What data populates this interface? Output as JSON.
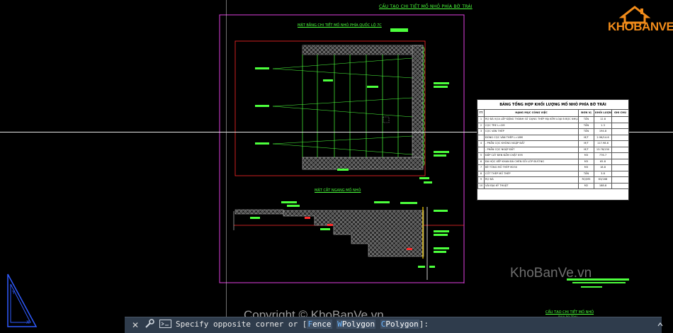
{
  "sheet_title": "CẤU TẠO CHI TIẾT MỐ NHỎ PHÍA BỜ TRÁI",
  "plan_view_label": "MẶT BẰNG CHI TIẾT MỐ NHỎ PHÍA QUỐC LỘ 7C",
  "section_view_label": "MẶT CẮT NGANG MỐ NHỎ",
  "bottom_right_label": "CẤU TẠO CHI TIẾT MỐ NHỎ",
  "bottom_right_sublabel": "PHIA BO TRAI",
  "quantity_table": {
    "title": "BẢNG TỔNG HỢP KHỐI LƯỢNG MỐ NHỎ PHÍA BỜ TRÁI",
    "headers": [
      "TT",
      "HẠNG MỤC CÔNG VIỆC",
      "ĐƠN VỊ",
      "KHỐI LƯỢNG",
      "GHI CHÚ"
    ],
    "rows": [
      [
        "1",
        "RỌ ĐÁ VỰA LẮP ĐẶNG THÀNH SỬ DỤNG THÉP MẠ KẼM LOẠI B BỌC NHỰA PVC",
        "TẤN",
        "12.8",
        ""
      ],
      [
        "2",
        "CỌC TRE L=2M",
        "TẤN",
        "1.3",
        ""
      ],
      [
        "3",
        "CỌC VÁN THÉP",
        "TẤN",
        "194.8",
        ""
      ],
      [
        "",
        "ĐÓNG CỌC VÁN THÉP L=18M",
        "M/T",
        "2.96/14.6",
        ""
      ],
      [
        "4",
        "- PHẦN CỌC KHÔNG NGẬP ĐẤT",
        "M/T",
        "117.98.6",
        ""
      ],
      [
        "",
        "- PHẦN CỌC NGẬP ĐẤT",
        "M/T",
        "13.78/150",
        ""
      ],
      [
        "5",
        "ĐẮP CÁT ĐEN ĐẦM CHẶT K95",
        "M3",
        "776.7",
        ""
      ],
      [
        "6",
        "ĐÁ HỘC XẾP KHAN ĐÁ CHÈN SỎI LỚP ĐƯỜNG",
        "M3",
        "65.8",
        ""
      ],
      [
        "7",
        "BÊ TÔNG MỐ THÉP M250",
        "M3",
        "18.8",
        ""
      ],
      [
        "8",
        "CỐT THÉP MỐ THÉP",
        "TẤN",
        "3.8",
        ""
      ],
      [
        "9",
        "RỌ ĐÁ",
        "RỌ/M3",
        "63/168",
        ""
      ],
      [
        "10",
        "VẢI ĐỊA KỸ THUẬT",
        "M2",
        "188.8",
        ""
      ]
    ]
  },
  "watermarks": {
    "logo_text": "KHOBANVE",
    "site": "KhoBanVe.vn",
    "copyright": "Copyright © KhoBanVe.vn"
  },
  "command_line": {
    "prompt": "Specify opposite corner or [",
    "opt1_key": "F",
    "opt1_rest": "ence",
    "opt2_key": "W",
    "opt2_rest": "Polygon",
    "opt3_key": "C",
    "opt3_rest": "Polygon",
    "suffix": "]:"
  },
  "colors": {
    "canvas": "#000000",
    "cad_green": "#4CFF3C",
    "frame_magenta": "#E040E0",
    "red": "#FF2A2A",
    "cmd_bar": "#2f3c4c",
    "logo_orange": "#F28C1A"
  }
}
